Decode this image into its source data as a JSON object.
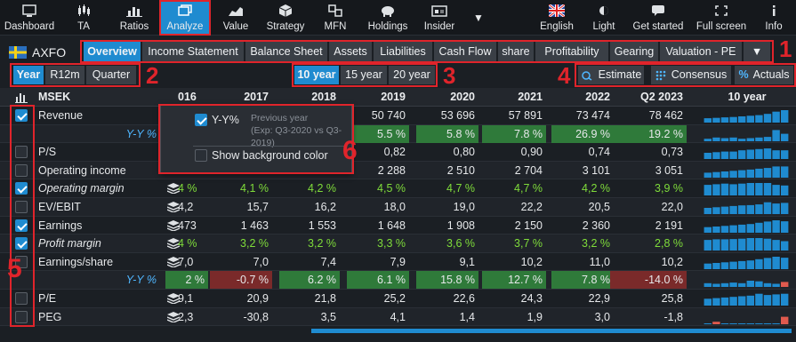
{
  "nav": {
    "left": [
      {
        "label": "Dashboard",
        "icon": "dashboard-icon"
      },
      {
        "label": "TA",
        "icon": "candlestick-icon"
      },
      {
        "label": "Ratios",
        "icon": "bar-chart-icon"
      },
      {
        "label": "Analyze",
        "icon": "window-icon"
      },
      {
        "label": "Value",
        "icon": "area-chart-icon"
      },
      {
        "label": "Strategy",
        "icon": "cube-icon"
      },
      {
        "label": "MFN",
        "icon": "mfn-icon"
      },
      {
        "label": "Holdings",
        "icon": "piggy-bank-icon"
      },
      {
        "label": "Insider",
        "icon": "id-card-icon"
      }
    ],
    "more_label": "▼",
    "right": [
      {
        "label": "English",
        "icon": "uk-flag-icon"
      },
      {
        "label": "Light",
        "icon": "sun-icon"
      },
      {
        "label": "Get started",
        "icon": "chat-icon"
      },
      {
        "label": "Full screen",
        "icon": "fullscreen-icon"
      },
      {
        "label": "Info",
        "icon": "info-icon"
      }
    ]
  },
  "company": {
    "ticker": "AXFO",
    "flag": "sweden-flag-icon"
  },
  "tabs": [
    "Overview",
    "Income Statement",
    "Balance Sheet",
    "Assets",
    "Liabilities",
    "Cash Flow",
    "share",
    "Profitability",
    "Gearing",
    "Valuation - PE"
  ],
  "tabs_more": "▼",
  "period_buttons": [
    "Year",
    "R12m",
    "Quarter"
  ],
  "range_buttons": [
    "10 year",
    "15 year",
    "20 year"
  ],
  "source_buttons": [
    {
      "label": "Estimate",
      "icon": "estimate-icon"
    },
    {
      "label": "Consensus",
      "icon": "consensus-icon"
    },
    {
      "label": "Actuals",
      "icon": "percent-icon"
    }
  ],
  "annotations": [
    "1",
    "2",
    "3",
    "4",
    "5",
    "6"
  ],
  "table": {
    "currency": "MSEK",
    "columns": [
      "016",
      "2017",
      "2018",
      "2019",
      "2020",
      "2021",
      "2022",
      "Q2 2023"
    ],
    "spark_header": "10 year",
    "rows": [
      {
        "label": "Revenue",
        "italic": false,
        "checked": true,
        "stack": false,
        "green": false,
        "values": [
          "",
          "",
          "",
          "50 740",
          "53 696",
          "57 891",
          "73 474",
          "78 462"
        ],
        "spark": [
          0.35,
          0.38,
          0.42,
          0.45,
          0.5,
          0.55,
          0.6,
          0.7,
          0.88,
          1.0
        ]
      },
      {
        "label": "Y-Y %",
        "yy": true,
        "values": [
          "",
          "",
          "",
          "5.5 %",
          "5.8 %",
          "7.8 %",
          "26.9 %",
          "19.2 %"
        ],
        "neg": [
          false,
          false,
          false,
          false,
          false,
          false,
          false,
          false
        ],
        "spark": [
          0.2,
          0.3,
          0.25,
          0.3,
          0.2,
          0.25,
          0.3,
          0.35,
          0.9,
          0.6
        ]
      },
      {
        "label": "P/S",
        "italic": false,
        "checked": false,
        "stack": true,
        "green": false,
        "values": [
          "",
          "",
          "",
          "0,82",
          "0,80",
          "0,90",
          "0,74",
          "0,73"
        ],
        "spark": [
          0.5,
          0.55,
          0.6,
          0.6,
          0.7,
          0.75,
          0.8,
          0.85,
          0.7,
          0.7
        ]
      },
      {
        "label": "Operating income",
        "italic": false,
        "checked": false,
        "stack": false,
        "green": false,
        "values": [
          "",
          "",
          "",
          "2 288",
          "2 510",
          "2 704",
          "3 101",
          "3 051"
        ],
        "spark": [
          0.4,
          0.45,
          0.5,
          0.55,
          0.6,
          0.65,
          0.72,
          0.78,
          0.9,
          0.9
        ]
      },
      {
        "label": "Operating margin",
        "italic": true,
        "checked": true,
        "stack": true,
        "green": true,
        "values": [
          "4 %",
          "4,1 %",
          "4,2 %",
          "4,5 %",
          "4,7 %",
          "4,7 %",
          "4,2 %",
          "3,9 %"
        ],
        "spark": [
          0.85,
          0.9,
          0.95,
          0.9,
          0.95,
          1.0,
          1.0,
          1.0,
          0.85,
          0.8
        ]
      },
      {
        "label": "EV/EBIT",
        "italic": false,
        "checked": false,
        "stack": true,
        "green": false,
        "values": [
          "4,2",
          "15,7",
          "16,2",
          "18,0",
          "19,0",
          "22,2",
          "20,5",
          "22,0"
        ],
        "spark": [
          0.5,
          0.55,
          0.6,
          0.65,
          0.7,
          0.72,
          0.78,
          0.95,
          0.85,
          0.9
        ]
      },
      {
        "label": "Earnings",
        "italic": false,
        "checked": true,
        "stack": true,
        "green": false,
        "values": [
          "473",
          "1 463",
          "1 553",
          "1 648",
          "1 908",
          "2 150",
          "2 360",
          "2 191"
        ],
        "spark": [
          0.45,
          0.5,
          0.55,
          0.6,
          0.65,
          0.7,
          0.8,
          0.9,
          1.0,
          0.92
        ]
      },
      {
        "label": "Profit margin",
        "italic": true,
        "checked": true,
        "stack": true,
        "green": true,
        "values": [
          "4 %",
          "3,2 %",
          "3,2 %",
          "3,3 %",
          "3,6 %",
          "3,7 %",
          "3,2 %",
          "2,8 %"
        ],
        "spark": [
          0.85,
          0.9,
          0.9,
          0.92,
          0.95,
          1.0,
          1.0,
          0.95,
          0.85,
          0.75
        ]
      },
      {
        "label": "Earnings/share",
        "italic": false,
        "checked": false,
        "stack": true,
        "green": false,
        "values": [
          "7,0",
          "7,0",
          "7,4",
          "7,9",
          "9,1",
          "10,2",
          "11,0",
          "10,2"
        ],
        "spark": [
          0.45,
          0.5,
          0.55,
          0.6,
          0.65,
          0.7,
          0.8,
          0.9,
          1.0,
          0.92
        ]
      },
      {
        "label": "Y-Y %",
        "yy": true,
        "values": [
          "2 %",
          "-0.7 %",
          "6.2 %",
          "6.1 %",
          "15.8 %",
          "12.7 %",
          "7.8 %",
          "-14.0 %"
        ],
        "neg": [
          false,
          true,
          false,
          false,
          false,
          false,
          false,
          true
        ],
        "spark": [
          0.3,
          0.25,
          0.3,
          0.35,
          0.3,
          0.5,
          0.45,
          0.3,
          0.25,
          -0.4
        ]
      },
      {
        "label": "P/E",
        "italic": false,
        "checked": false,
        "stack": true,
        "green": false,
        "values": [
          "9,1",
          "20,9",
          "21,8",
          "25,2",
          "22,6",
          "24,3",
          "22,9",
          "25,8"
        ],
        "spark": [
          0.55,
          0.6,
          0.65,
          0.7,
          0.75,
          0.8,
          0.95,
          0.85,
          0.9,
          0.95
        ]
      },
      {
        "label": "PEG",
        "italic": false,
        "checked": false,
        "stack": true,
        "green": false,
        "values": [
          "2,3",
          "-30,8",
          "3,5",
          "4,1",
          "1,4",
          "1,9",
          "3,0",
          "-1,8"
        ],
        "spark": [
          0.05,
          -0.2,
          0.05,
          0.05,
          0.05,
          0.05,
          0.05,
          0.05,
          0.05,
          -0.6
        ]
      }
    ]
  },
  "popup": {
    "yy_label": "Y-Y%",
    "yy_checked": true,
    "yy_desc_title": "Previous year",
    "yy_desc_detail": "(Exp: Q3-2020 vs Q3-2019)",
    "bg_label": "Show background color",
    "bg_checked": false
  },
  "colors": {
    "accent": "#1f8bd0",
    "annotation": "#e0242b",
    "positive": "#7fdc3a",
    "negative": "#e05a4e",
    "yy_positive_bg": "#2f7a3a",
    "yy_negative_bg": "#7a2a2a"
  }
}
